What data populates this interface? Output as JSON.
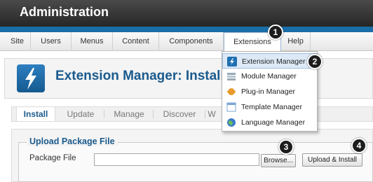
{
  "header": {
    "title": "Administration"
  },
  "menu": {
    "items": [
      "Site",
      "Users",
      "Menus",
      "Content",
      "Components",
      "Extensions",
      "Help"
    ],
    "active": "Extensions"
  },
  "extensions_menu": {
    "items": [
      {
        "label": "Extension Manager",
        "icon": "extension-manager-icon",
        "highlighted": true
      },
      {
        "label": "Module Manager",
        "icon": "module-manager-icon"
      },
      {
        "label": "Plug-in Manager",
        "icon": "plugin-manager-icon"
      },
      {
        "label": "Template Manager",
        "icon": "template-manager-icon"
      },
      {
        "label": "Language Manager",
        "icon": "language-manager-icon"
      }
    ]
  },
  "page": {
    "title": "Extension Manager: Install",
    "icon": "lightning-icon"
  },
  "tabs": {
    "items": [
      "Install",
      "Update",
      "Manage",
      "Discover",
      "W"
    ],
    "active": "Install"
  },
  "upload": {
    "legend": "Upload Package File",
    "field_label": "Package File",
    "browse_label": "Browse...",
    "install_label": "Upload & Install"
  },
  "callouts": [
    "1",
    "2",
    "3",
    "4"
  ],
  "colors": {
    "header_dark": "#262626",
    "accent_blue": "#1a6ea8",
    "title_blue": "#1a5a8d",
    "highlight": "#dde9f6"
  }
}
